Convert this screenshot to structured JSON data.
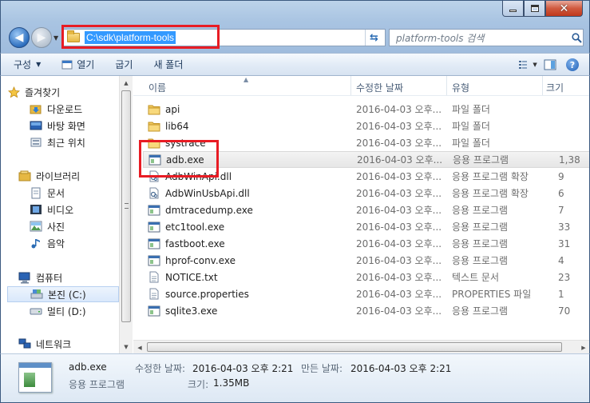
{
  "window": {
    "address_path": "C:\\sdk\\platform-tools",
    "search_placeholder": "platform-tools 검색"
  },
  "toolbar": {
    "organize": "구성",
    "open": "열기",
    "burn": "굽기",
    "new_folder": "새 폴더"
  },
  "sidebar": {
    "favorites": {
      "label": "즐겨찾기",
      "items": [
        "다운로드",
        "바탕 화면",
        "최근 위치"
      ]
    },
    "libraries": {
      "label": "라이브러리",
      "items": [
        "문서",
        "비디오",
        "사진",
        "음악"
      ]
    },
    "computer": {
      "label": "컴퓨터",
      "items": [
        "본진 (C:)",
        "멀티 (D:)"
      ]
    },
    "network": {
      "label": "네트워크"
    }
  },
  "columns": {
    "name": "이름",
    "date": "수정한 날짜",
    "type": "유형",
    "size": "크기"
  },
  "files": [
    {
      "name": "api",
      "date": "2016-04-03 오후...",
      "type": "파일 폴더",
      "size": "",
      "icon": "folder-icon"
    },
    {
      "name": "lib64",
      "date": "2016-04-03 오후...",
      "type": "파일 폴더",
      "size": "",
      "icon": "folder-icon"
    },
    {
      "name": "systrace",
      "date": "2016-04-03 오후...",
      "type": "파일 폴더",
      "size": "",
      "icon": "folder-icon"
    },
    {
      "name": "adb.exe",
      "date": "2016-04-03 오후...",
      "type": "응용 프로그램",
      "size": "1,38",
      "icon": "exe-icon"
    },
    {
      "name": "AdbWinApi.dll",
      "date": "2016-04-03 오후...",
      "type": "응용 프로그램 확장",
      "size": "9",
      "icon": "dll-icon"
    },
    {
      "name": "AdbWinUsbApi.dll",
      "date": "2016-04-03 오후...",
      "type": "응용 프로그램 확장",
      "size": "6",
      "icon": "dll-icon"
    },
    {
      "name": "dmtracedump.exe",
      "date": "2016-04-03 오후...",
      "type": "응용 프로그램",
      "size": "7",
      "icon": "exe-icon"
    },
    {
      "name": "etc1tool.exe",
      "date": "2016-04-03 오후...",
      "type": "응용 프로그램",
      "size": "33",
      "icon": "exe-icon"
    },
    {
      "name": "fastboot.exe",
      "date": "2016-04-03 오후...",
      "type": "응용 프로그램",
      "size": "31",
      "icon": "exe-icon"
    },
    {
      "name": "hprof-conv.exe",
      "date": "2016-04-03 오후...",
      "type": "응용 프로그램",
      "size": "4",
      "icon": "exe-icon"
    },
    {
      "name": "NOTICE.txt",
      "date": "2016-04-03 오후...",
      "type": "텍스트 문서",
      "size": "23",
      "icon": "text-file-icon"
    },
    {
      "name": "source.properties",
      "date": "2016-04-03 오후...",
      "type": "PROPERTIES 파일",
      "size": "1",
      "icon": "text-file-icon"
    },
    {
      "name": "sqlite3.exe",
      "date": "2016-04-03 오후...",
      "type": "응용 프로그램",
      "size": "70",
      "icon": "exe-icon"
    }
  ],
  "details": {
    "name": "adb.exe",
    "type": "응용 프로그램",
    "modified_label": "수정한 날짜:",
    "modified_value": "2016-04-03 오후 2:21",
    "created_label": "만든 날짜:",
    "created_value": "2016-04-03 오후 2:21",
    "size_label": "크기:",
    "size_value": "1.35MB"
  },
  "colors": {
    "highlight": "#e81c24",
    "selection": "#3399ff"
  }
}
